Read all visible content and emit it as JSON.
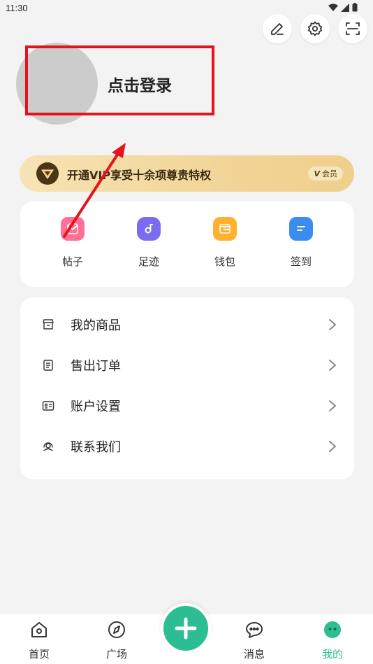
{
  "status_bar": {
    "time": "11:30"
  },
  "top_actions": {
    "edit_icon": "pencil-icon",
    "settings_icon": "gear-icon",
    "scan_icon": "scan-icon"
  },
  "profile": {
    "login_label": "点击登录"
  },
  "vip": {
    "text": "开通VIP享受十余项尊贵特权",
    "tag_prefix": "V",
    "tag_label": "会员",
    "accent": "#f2d598"
  },
  "quick": {
    "items": [
      {
        "label": "帖子",
        "icon": "post-icon",
        "color": "#ff5b8a"
      },
      {
        "label": "足迹",
        "icon": "footprint-icon",
        "color": "#7a6cf0"
      },
      {
        "label": "钱包",
        "icon": "wallet-icon",
        "color": "#ffb02e"
      },
      {
        "label": "签到",
        "icon": "checkin-icon",
        "color": "#3b8cf0"
      }
    ]
  },
  "menu": {
    "items": [
      {
        "label": "我的商品",
        "icon": "store-icon"
      },
      {
        "label": "售出订单",
        "icon": "order-icon"
      },
      {
        "label": "账户设置",
        "icon": "account-card-icon"
      },
      {
        "label": "联系我们",
        "icon": "headset-icon"
      }
    ]
  },
  "bottom_nav": {
    "items": [
      {
        "label": "首页",
        "icon": "home-icon"
      },
      {
        "label": "广场",
        "icon": "compass-icon"
      },
      {
        "label": "消息",
        "icon": "message-icon"
      },
      {
        "label": "我的",
        "icon": "profile-face-icon"
      }
    ],
    "active_color": "#2cbd93",
    "fab_icon": "plus-icon"
  },
  "annotation": {
    "color": "#e3141c"
  }
}
